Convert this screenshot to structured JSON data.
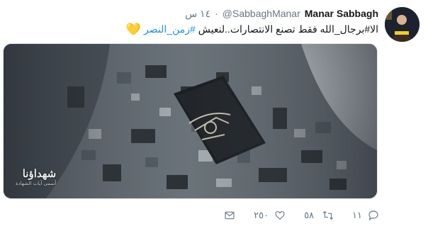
{
  "tweet": {
    "display_name": "Manar Sabbagh",
    "handle": "@SabbaghManar",
    "separator": "·",
    "time": "١٤ س",
    "text_plain": "الا#برجال_الله فقط تصنع الانتصارات..لنعيش",
    "hashtag": "#زمن_النصر",
    "emoji": "yellow-heart",
    "emoji_char": "💛"
  },
  "media": {
    "watermark_title": "شهداؤنا",
    "watermark_subtitle": "أسمى آيات الشهادة"
  },
  "actions": {
    "reply_count": "١١",
    "retweet_count": "٥٨",
    "like_count": "٢٥٠",
    "icons": [
      "reply-icon",
      "retweet-icon",
      "like-icon",
      "dm-icon"
    ]
  },
  "colors": {
    "link": "#1b95e0",
    "secondary_text": "#657786",
    "heart": "#f5c21b"
  }
}
